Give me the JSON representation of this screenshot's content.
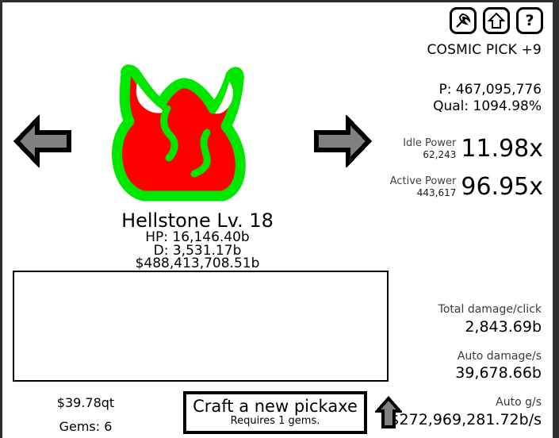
{
  "icon_bar": {
    "buttons": [
      {
        "name": "pickaxe-icon",
        "label": "Pickaxe"
      },
      {
        "name": "upgrade-arrow-icon",
        "label": "Upgrade"
      },
      {
        "name": "help-question-icon",
        "label": "Help"
      }
    ]
  },
  "pickaxe": {
    "name": "COSMIC PICK +9",
    "power_line": "P: 467,095,776",
    "quality_line": "Qual: 1094.98%"
  },
  "power": {
    "idle": {
      "label": "Idle Power",
      "value": "62,243",
      "multiplier": "11.98x"
    },
    "active": {
      "label": "Active Power",
      "value": "443,617",
      "multiplier": "96.95x"
    }
  },
  "damage": {
    "total_per_click": {
      "label": "Total damage/click",
      "value": "2,843.69b"
    },
    "auto_per_second": {
      "label": "Auto damage/s",
      "value": "39,678.66b"
    },
    "auto_gold_per_second": {
      "label": "Auto g/s",
      "value": "$272,969,281.72b/s"
    }
  },
  "monster": {
    "name": "Hellstone Lv. 18",
    "hp": "HP: 16,146.40b",
    "defense": "D: 3,531.17b",
    "reward": "$488,413,708.51b",
    "sprite_name": "hellstone-rock-sprite",
    "body_color": "#ff0000",
    "outline_color": "#00e800"
  },
  "navigation": {
    "prev_label": "Previous monster",
    "next_label": "Next monster",
    "arrow_fill": "#808080",
    "arrow_outline": "#000000"
  },
  "log_panel": {
    "text": ""
  },
  "currency": {
    "money": "$39.78qt",
    "gems": "Gems: 6"
  },
  "craft": {
    "title": "Craft a new pickaxe",
    "subtitle": "Requires 1 gems.",
    "upgrade_arrow_name": "craft-upgrade-arrow-icon"
  }
}
